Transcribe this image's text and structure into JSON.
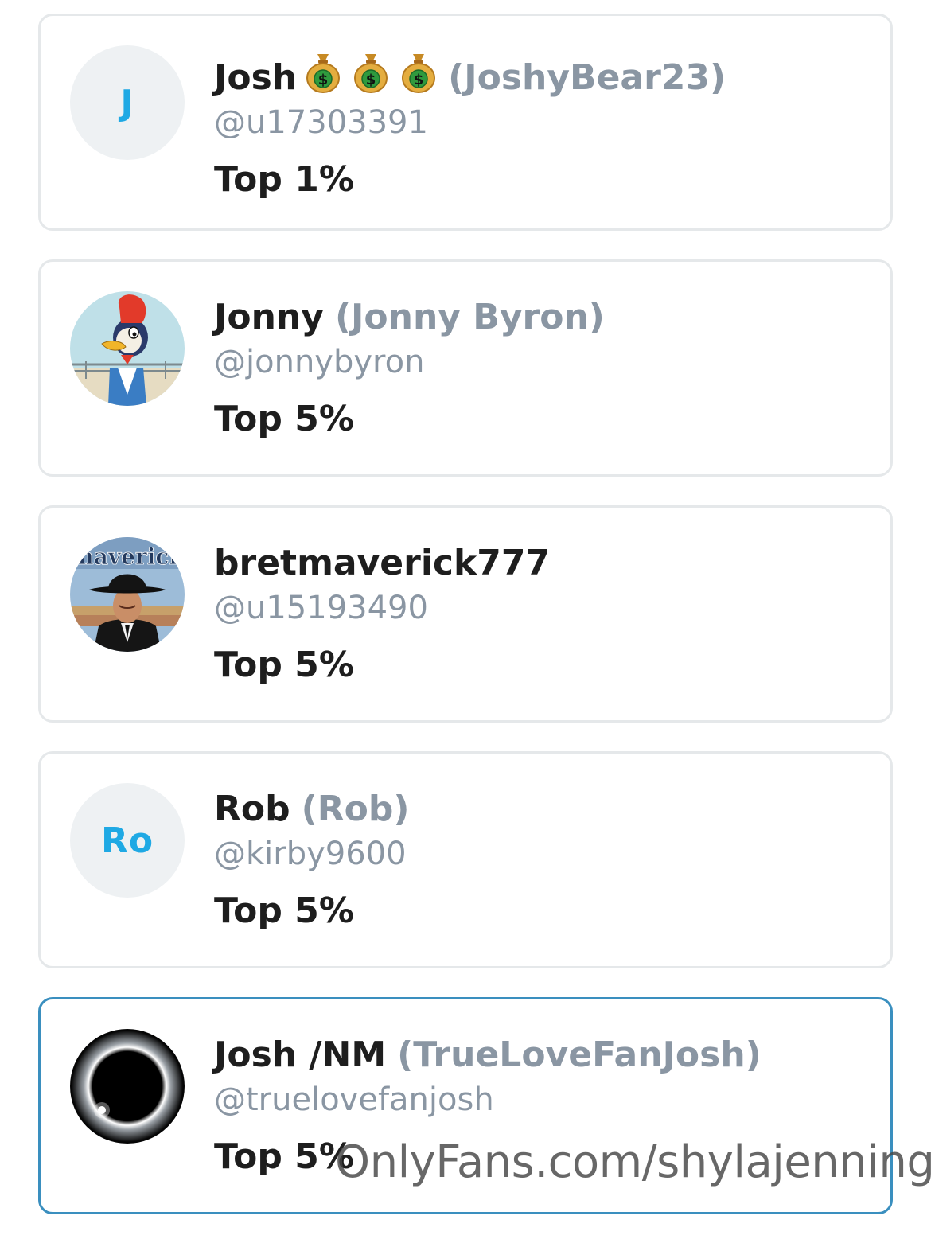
{
  "fans": [
    {
      "display_name": "Josh",
      "has_badges": true,
      "badge_icon": "money-bag-icon",
      "alias": "(JoshyBear23)",
      "username": "@u17303391",
      "rank": "Top 1%",
      "avatar_type": "initials",
      "avatar_initials": "J"
    },
    {
      "display_name": "Jonny",
      "alias": "(Jonny Byron)",
      "username": "@jonnybyron",
      "rank": "Top 5%",
      "avatar_type": "image",
      "avatar_icon": "woodpecker-cartoon-avatar"
    },
    {
      "display_name": "bretmaverick777",
      "alias": "",
      "username": "@u15193490",
      "rank": "Top 5%",
      "avatar_type": "image",
      "avatar_icon": "cowboy-poster-avatar",
      "avatar_text": "maverick"
    },
    {
      "display_name": "Rob",
      "alias": "(Rob)",
      "username": "@kirby9600",
      "rank": "Top 5%",
      "avatar_type": "initials",
      "avatar_initials": "Ro"
    },
    {
      "display_name": "Josh /NM",
      "alias": "(TrueLoveFanJosh)",
      "username": "@truelovefanjosh",
      "rank": "Top 5%",
      "avatar_type": "image",
      "avatar_icon": "solar-eclipse-avatar",
      "highlighted": true
    }
  ],
  "watermark": "OnlyFans.com/shylajennings",
  "colors": {
    "card_border": "#e5e8ea",
    "highlight_border": "#3a8fbf",
    "initials_text": "#1fa9e4",
    "secondary_text": "#8a96a3",
    "primary_text": "#1e1e1e"
  }
}
